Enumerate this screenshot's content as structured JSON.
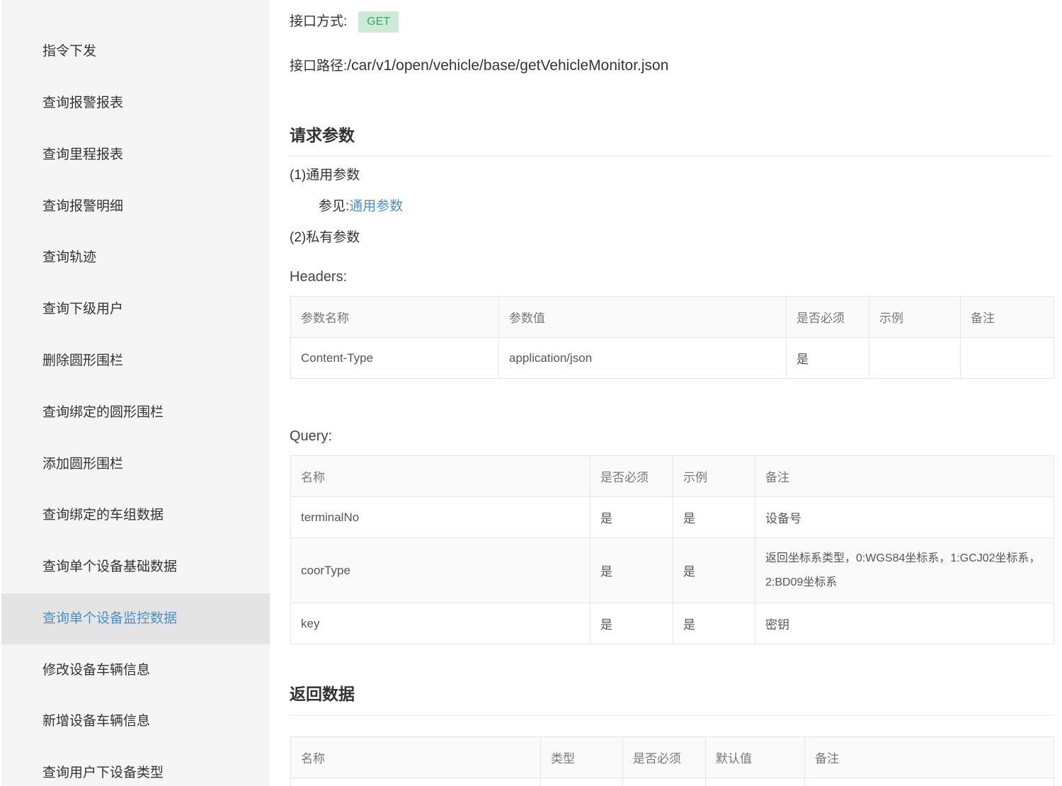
{
  "sidebar": {
    "items": [
      {
        "label": "指令下发"
      },
      {
        "label": "查询报警报表"
      },
      {
        "label": "查询里程报表"
      },
      {
        "label": "查询报警明细"
      },
      {
        "label": "查询轨迹"
      },
      {
        "label": "查询下级用户"
      },
      {
        "label": "删除圆形围栏"
      },
      {
        "label": "查询绑定的圆形围栏"
      },
      {
        "label": "添加圆形围栏"
      },
      {
        "label": "查询绑定的车组数据"
      },
      {
        "label": "查询单个设备基础数据"
      },
      {
        "label": "查询单个设备监控数据",
        "active": true
      },
      {
        "label": "修改设备车辆信息"
      },
      {
        "label": "新增设备车辆信息"
      },
      {
        "label": "查询用户下设备类型"
      }
    ]
  },
  "api": {
    "method_label": "接口方式:",
    "method": "GET",
    "path_label": "接口路径:",
    "path": "/car/v1/open/vehicle/base/getVehicleMonitor.json"
  },
  "request": {
    "title": "请求参数",
    "common_label": "(1)通用参数",
    "see_prefix": "参见:",
    "see_link": "通用参数",
    "private_label": "(2)私有参数"
  },
  "headers": {
    "label": "Headers:",
    "columns": [
      "参数名称",
      "参数值",
      "是否必须",
      "示例",
      "备注"
    ],
    "rows": [
      [
        "Content-Type",
        "application/json",
        "是",
        "",
        ""
      ]
    ]
  },
  "query": {
    "label": "Query:",
    "columns": [
      "名称",
      "是否必须",
      "示例",
      "备注"
    ],
    "rows": [
      [
        "terminalNo",
        "是",
        "是",
        "设备号"
      ],
      [
        "coorType",
        "是",
        "是",
        "返回坐标系类型，0:WGS84坐标系，1:GCJ02坐标系，2:BD09坐标系"
      ],
      [
        "key",
        "是",
        "是",
        "密钥"
      ]
    ]
  },
  "response": {
    "title": "返回数据",
    "columns": [
      "名称",
      "类型",
      "是否必须",
      "默认值",
      "备注"
    ]
  },
  "colors": {
    "accent": "#4a90c9",
    "method_bg": "#cfe9d9",
    "method_text": "#3aa46a",
    "sidebar_bg": "#f5f5f5",
    "sidebar_active_bg": "#e4e4e4"
  }
}
